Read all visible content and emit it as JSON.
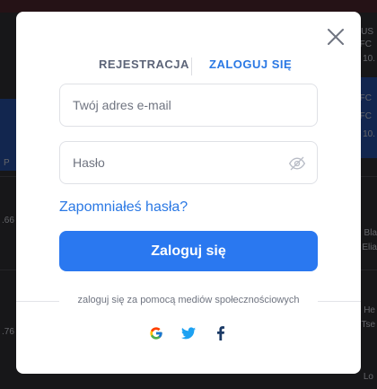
{
  "modal": {
    "tabs": [
      {
        "label": "REJESTRACJA",
        "active": false
      },
      {
        "label": "ZALOGUJ SIĘ",
        "active": true
      }
    ],
    "email": {
      "placeholder": "Twój adres e-mail",
      "value": ""
    },
    "password": {
      "placeholder": "Hasło",
      "value": ""
    },
    "forgot_label": "Zapomniałeś hasła?",
    "login_label": "Zaloguj się",
    "social_label": "zaloguj się za pomocą mediów społecznościowych",
    "social_icons": [
      "google-icon",
      "twitter-icon",
      "facebook-icon"
    ],
    "close_icon": "close-icon",
    "eye_icon": "eye-off-icon"
  },
  "background": {
    "right_texts": [
      "US",
      "FC",
      "FC",
      "FC",
      "10.",
      "10.",
      "Bla",
      "Elia",
      "He",
      "Tse",
      "Lo"
    ],
    "left_texts": [
      "P",
      ".66",
      ".76"
    ]
  },
  "colors": {
    "accent": "#2a78f0",
    "link": "#2a78e4",
    "tab_inactive": "#5c6478"
  }
}
